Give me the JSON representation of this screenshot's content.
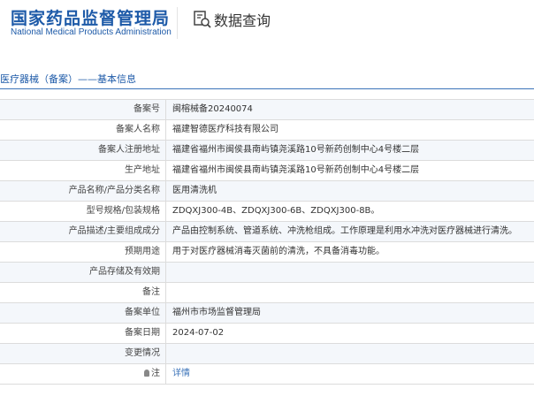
{
  "header": {
    "logo_cn": "国家药品监督管理局",
    "logo_en": "National Medical Products Administration",
    "query_label": "数据查询"
  },
  "breadcrumb": "医疗器械（备案）——基本信息",
  "rows": [
    {
      "label": "备案号",
      "value": "闽榕械备20240074"
    },
    {
      "label": "备案人名称",
      "value": "福建智德医疗科技有限公司"
    },
    {
      "label": "备案人注册地址",
      "value": "福建省福州市闽侯县南屿镇尧溪路10号新药创制中心4号楼二层"
    },
    {
      "label": "生产地址",
      "value": "福建省福州市闽侯县南屿镇尧溪路10号新药创制中心4号楼二层"
    },
    {
      "label": "产品名称/产品分类名称",
      "value": "医用清洗机"
    },
    {
      "label": "型号规格/包装规格",
      "value": "ZDQXJ300-4B、ZDQXJ300-6B、ZDQXJ300-8B。"
    },
    {
      "label": "产品描述/主要组成成分",
      "value": "产品由控制系统、管道系统、冲洗枪组成。工作原理是利用水冲洗对医疗器械进行清洗。"
    },
    {
      "label": "预期用途",
      "value": "用于对医疗器械消毒灭菌前的清洗，不具备消毒功能。"
    },
    {
      "label": "产品存储及有效期",
      "value": ""
    },
    {
      "label": "备注",
      "value": ""
    },
    {
      "label": "备案单位",
      "value": "福州市市场监督管理局"
    },
    {
      "label": "备案日期",
      "value": "2024-07-02"
    },
    {
      "label": "变更情况",
      "value": ""
    },
    {
      "label": "注",
      "value": "详情"
    }
  ]
}
